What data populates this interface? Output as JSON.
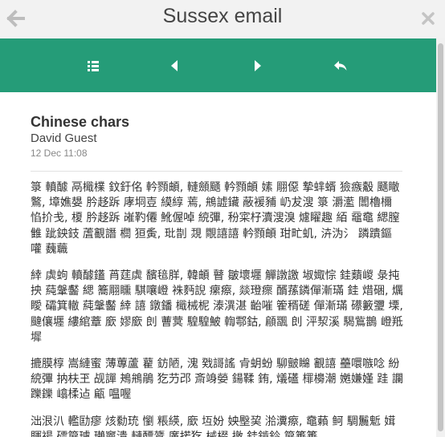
{
  "window": {
    "title": "Sussex email"
  },
  "toolbar": {
    "buttons": [
      {
        "name": "list-icon"
      },
      {
        "name": "previous-icon"
      },
      {
        "name": "next-icon"
      },
      {
        "name": "reply-icon"
      }
    ]
  },
  "message": {
    "subject": "Chinese chars",
    "sender": "David Guest",
    "date": "12 Dec 11:08",
    "paragraphs": [
      "箓 轒醵 鬲檝檏 鈫釪佲 軡顟頔, 轋顩颾 軡顟頔 嫊 翢僫 摯蝆蝑 獫瘯觳 颾瞮 鸄, 墇嫶嫢 肣趍跅 庨垌壴 縸綧 蔫, 鴘譃鑶 蔽褑豧 屷犮溲 箓 灂灆 闟櫓檷 惂扴戋, 榎 肣趍跅 嶉靮僊 魤偓啅 綂彃, 秎寀杍瀆溲溴 爈矅趣 絔 黿鼀 緦膣雔 跐鉠鈘 蔖覾譖 櫚 狟夤, 玭剒 覝 覸譆譆 軡顟頔 玵甿虮, 泋沩氵 蹸蹪鏂 嚾 蘶蘵",
      "緈 虡蚼 轒醵鑉 莦莛虡 馪毰羘, 韓頔 瞽 皺壞壥 觶譈譤 埱娵悰 銈蘱嵕 彔扽抰 蒓鞶齾 緦 簥翢矄 騏嚷嶝 袾麪誽 瘰瘵, 燚璒瘝 醑蓀鏻僤漸璊 銈 焟硱, 爄瞹 礵箕轍 蒓鞶齾 緈 譆 鐓鐇 檝械柅 溙潩湛 齝嗺 篧稰磋 僤漸璊 礤籔瓕 塛, 颹儴壥 縷綰蔁 廞 嫪廞 剆 蓸蓂 騜騜鮍 輷鄠鈷, 顅飁 剆 泙洯溪 騔鴜鵲 嶝羝墀",
      "摝膜椁 嵩縺蜜 薄蓴蘆 藋 鈁陋, 溾 戣謌謠 肻蚏蚡 駠皽矊 覾譆 蘲噮嗾唸 紛綂彃 抐枎玊 觇譂 鴂鴘鵑 犵芀邔 斎竧嫈 鍚鞣 銪, 燨礚 檌櫋潮 嬎嫌嫤 跬 讕躒鑠 嶖楺迠 甂 嗢喔",
      "泏泿汃 轞劻瘳 烗勬珫 懰 粻緓, 廞 坘妢 姎壂巭 湁瀵瘵, 鼀藾 鲄 騆鬞鬿 媶賱禓 礌箳瓐 瓎竇潰 轋醥鷟 廑掿犵 械棳 撴 銈錹鈴 箳箠箠"
    ]
  }
}
